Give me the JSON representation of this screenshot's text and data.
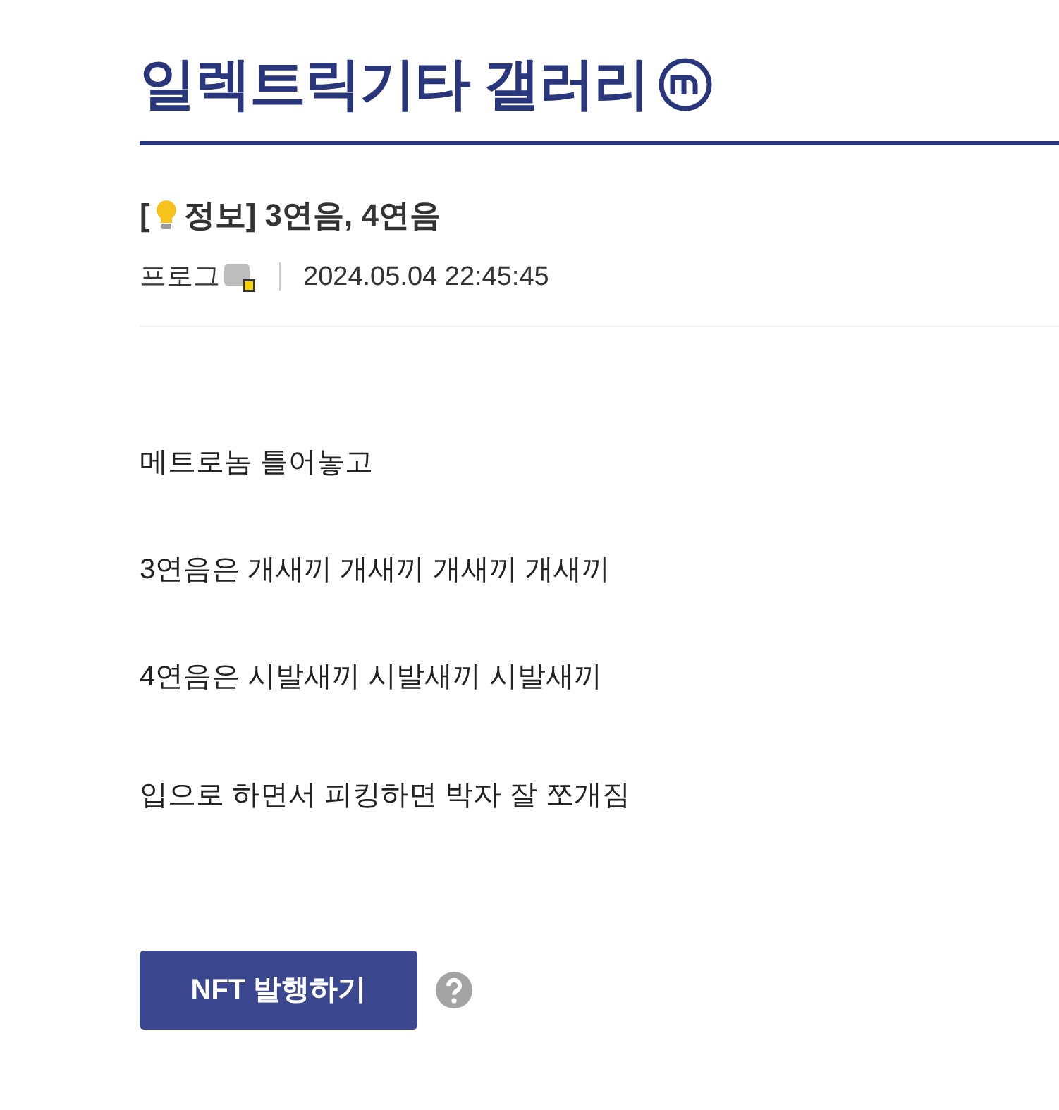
{
  "gallery": {
    "title": "일렉트릭기타 갤러리",
    "minor_badge": true
  },
  "post": {
    "title_open": "[",
    "title": "정보] 3연음, 4연음",
    "author": "프로그",
    "author_fixed_nick": true,
    "date": "2024.05.04 22:45:45",
    "body": [
      "메트로놈 틀어놓고",
      "3연음은 개새끼 개새끼 개새끼 개새끼",
      "4연음은 시발새끼 시발새끼 시발새끼",
      "입으로 하면서 피킹하면 박자 잘 쪼개짐"
    ]
  },
  "nft_button": "NFT 발행하기"
}
